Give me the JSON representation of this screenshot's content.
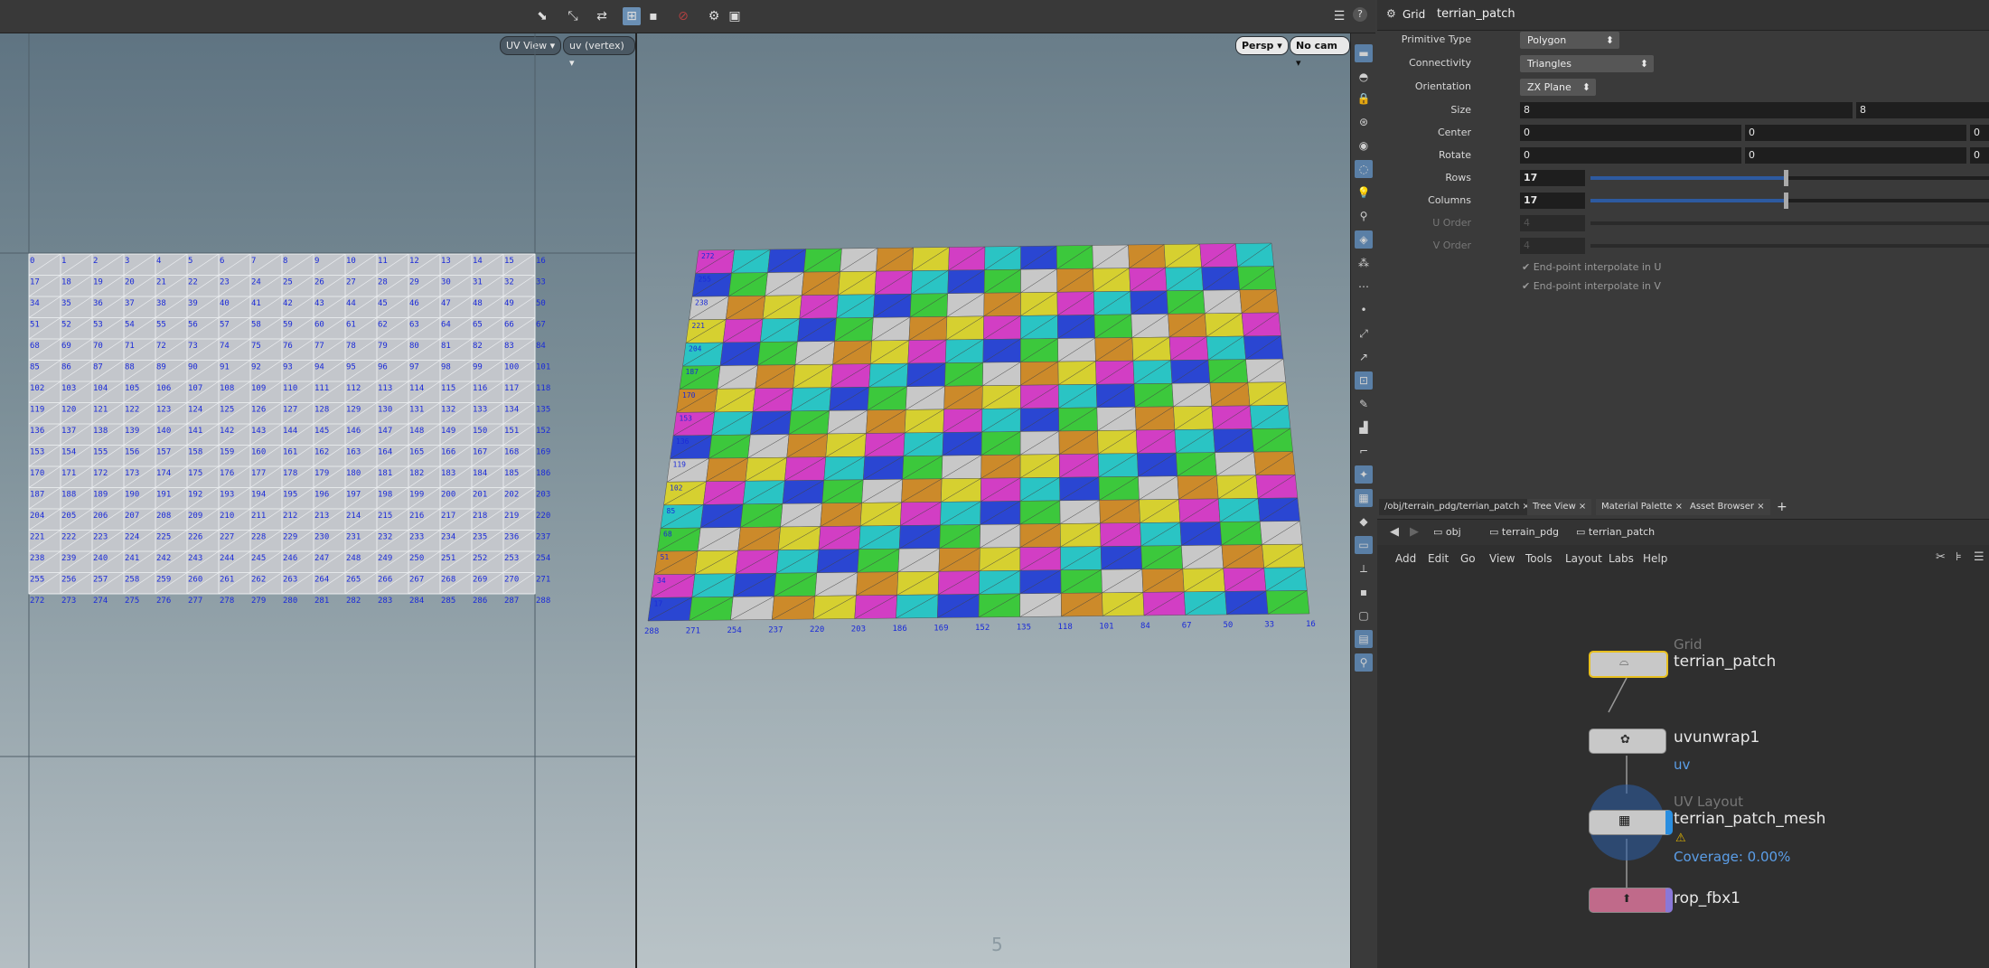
{
  "toolbar": {
    "help": "?"
  },
  "uv_view": {
    "view_menu": "UV View",
    "attr_menu": "uv (vertex)",
    "cols": 17,
    "max_index": 288
  },
  "viewport": {
    "persp": "Persp",
    "cam": "No cam",
    "bottom_label": "5"
  },
  "params": {
    "node_type": "Grid",
    "node_name": "terrian_patch",
    "primitive_type_label": "Primitive Type",
    "primitive_type": "Polygon",
    "connectivity_label": "Connectivity",
    "connectivity": "Triangles",
    "orientation_label": "Orientation",
    "orientation": "ZX Plane",
    "size_label": "Size",
    "size_x": "8",
    "size_y": "8",
    "center_label": "Center",
    "center": [
      "0",
      "0",
      "0"
    ],
    "rotate_label": "Rotate",
    "rotate": [
      "0",
      "0",
      "0"
    ],
    "rows_label": "Rows",
    "rows": "17",
    "columns_label": "Columns",
    "columns": "17",
    "uorder_label": "U Order",
    "uorder": "4",
    "vorder_label": "V Order",
    "vorder": "4",
    "interp_u": "End-point interpolate in U",
    "interp_v": "End-point interpolate in V"
  },
  "network": {
    "tabs": [
      "/obj/terrain_pdg/terrian_patch",
      "Tree View",
      "Material Palette",
      "Asset Browser"
    ],
    "path": [
      "obj",
      "terrain_pdg",
      "terrian_patch"
    ],
    "menu": [
      "Add",
      "Edit",
      "Go",
      "View",
      "Tools",
      "Layout",
      "Labs",
      "Help"
    ],
    "nodes": [
      {
        "type": "Grid",
        "name": "terrian_patch"
      },
      {
        "type": "",
        "name": "uvunwrap1",
        "sub": "uv"
      },
      {
        "type": "UV Layout",
        "name": "terrian_patch_mesh",
        "sub": "Coverage: 0.00%"
      },
      {
        "type": "",
        "name": "rop_fbx1"
      }
    ]
  }
}
